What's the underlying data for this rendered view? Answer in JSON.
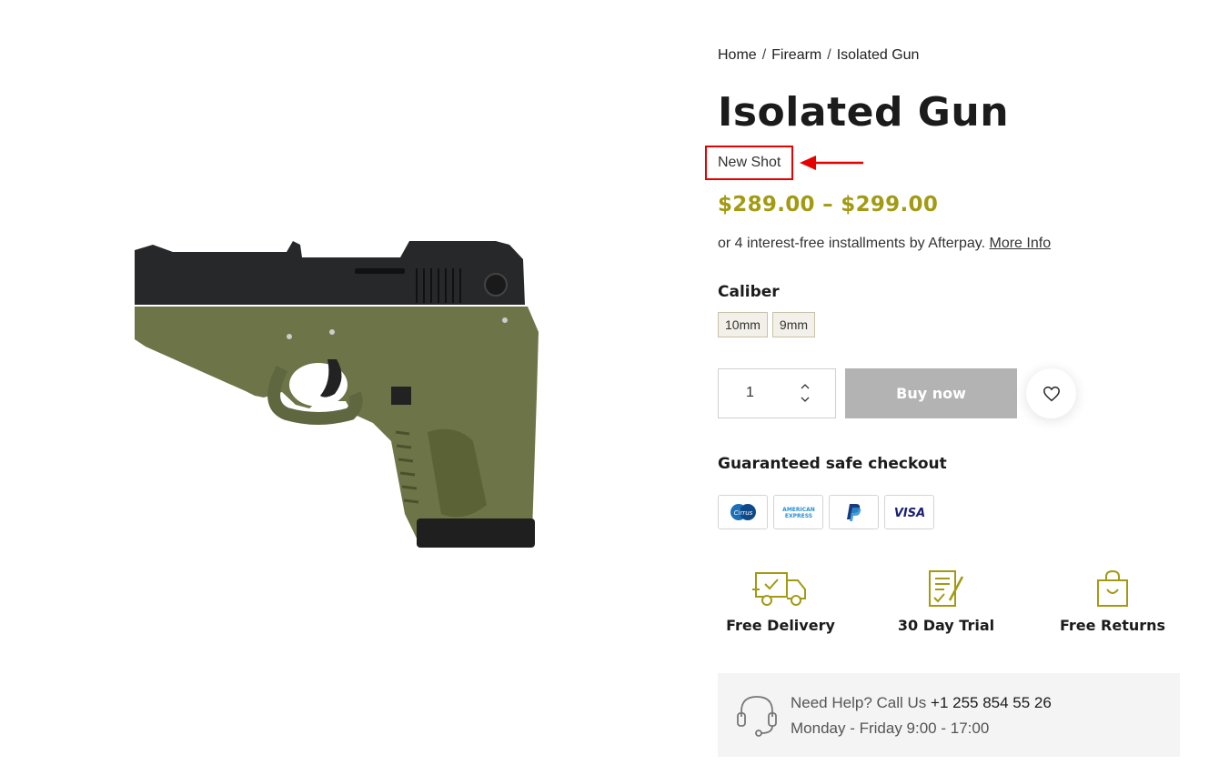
{
  "breadcrumb": [
    "Home",
    "Firearm",
    "Isolated Gun"
  ],
  "breadcrumb_sep": "/",
  "product": {
    "title": "Isolated Gun",
    "tag": "New Shot",
    "price": "$289.00 – $299.00",
    "price_color": "#a39a13"
  },
  "afterpay": {
    "text": "or 4 interest-free installments by Afterpay. ",
    "link": "More Info"
  },
  "caliber": {
    "label": "Caliber",
    "options": [
      "10mm",
      "9mm"
    ]
  },
  "purchase": {
    "quantity": "1",
    "buy_label": "Buy now"
  },
  "checkout": {
    "label": "Guaranteed safe checkout",
    "methods": [
      "Cirrus",
      "American Express",
      "PayPal",
      "VISA"
    ]
  },
  "features": [
    {
      "label": "Free Delivery",
      "icon": "delivery-truck-icon"
    },
    {
      "label": "30 Day Trial",
      "icon": "trial-document-icon"
    },
    {
      "label": "Free Returns",
      "icon": "shopping-bag-icon"
    }
  ],
  "help": {
    "prefix": "Need Help? Call Us ",
    "phone": "+1 255 854 55 26",
    "hours": "Monday - Friday 9:00 - 17:00"
  },
  "colors": {
    "accent": "#a39a13",
    "highlight_box": "#e60000",
    "pistol_frame": "#6d7548",
    "pistol_slide": "#26282a",
    "buy_disabled": "#b3b3b3"
  }
}
